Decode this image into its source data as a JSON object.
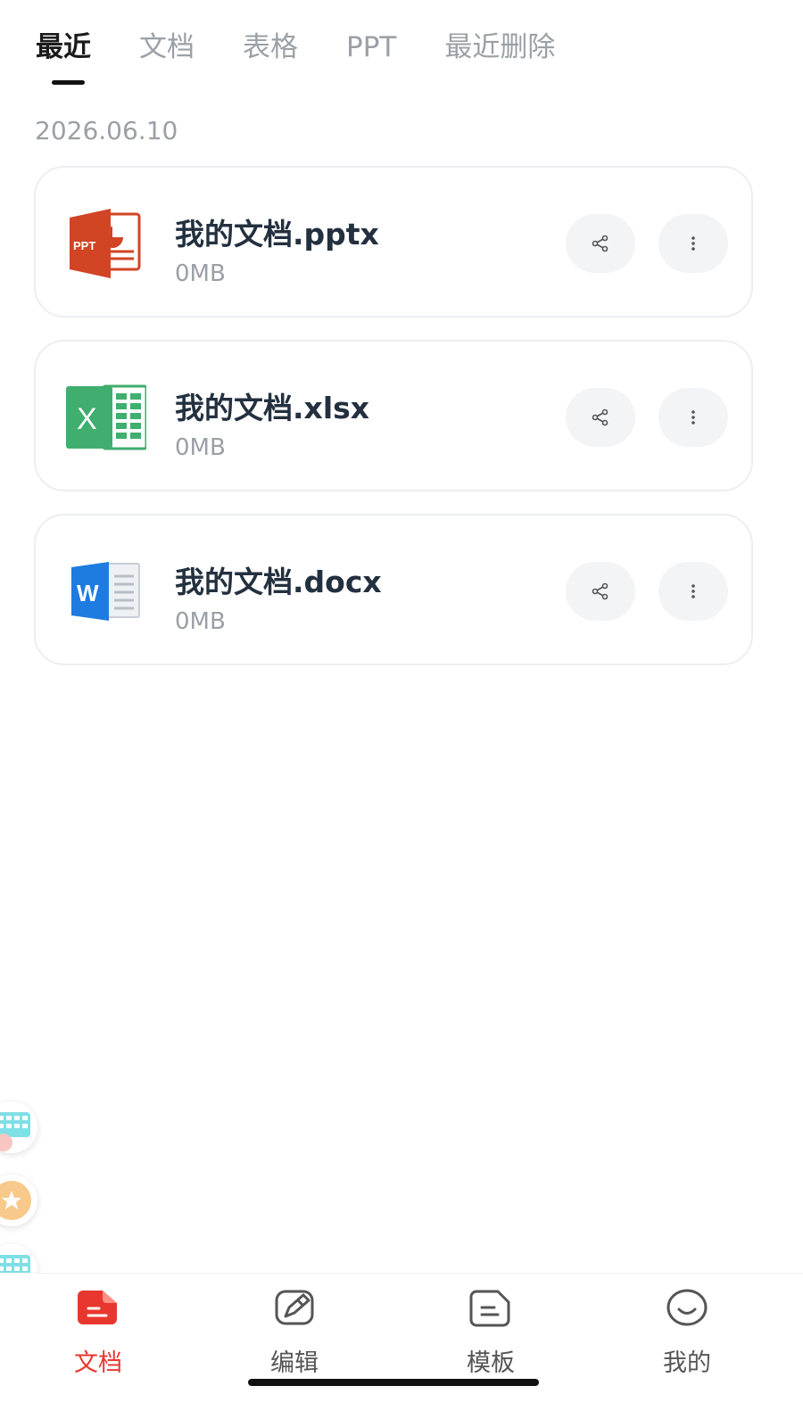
{
  "tabs": [
    {
      "label": "最近",
      "active": true
    },
    {
      "label": "文档",
      "active": false
    },
    {
      "label": "表格",
      "active": false
    },
    {
      "label": "PPT",
      "active": false
    },
    {
      "label": "最近删除",
      "active": false
    }
  ],
  "date_header": "2026.06.10",
  "files": [
    {
      "name": "我的文档.pptx",
      "size": "0MB",
      "icon": "ppt-file-icon",
      "icon_label": "PPT",
      "color": "#d14424"
    },
    {
      "name": "我的文档.xlsx",
      "size": "0MB",
      "icon": "excel-file-icon",
      "icon_label": "X",
      "color": "#3fae6e"
    },
    {
      "name": "我的文档.docx",
      "size": "0MB",
      "icon": "word-file-icon",
      "icon_label": "W",
      "color": "#1e7be0"
    }
  ],
  "bottom_nav": [
    {
      "label": "文档",
      "icon": "document-icon",
      "active": true
    },
    {
      "label": "编辑",
      "icon": "edit-brush-icon",
      "active": false
    },
    {
      "label": "模板",
      "icon": "template-icon",
      "active": false
    },
    {
      "label": "我的",
      "icon": "profile-icon",
      "active": false
    }
  ],
  "colors": {
    "accent": "#e8372e",
    "text_primary": "#23303f",
    "text_muted": "#9aa0a6"
  }
}
